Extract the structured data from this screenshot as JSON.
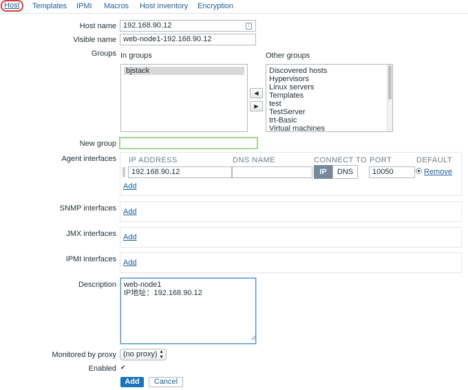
{
  "tabs": [
    {
      "label": "Host",
      "active": true
    },
    {
      "label": "Templates"
    },
    {
      "label": "IPMI"
    },
    {
      "label": "Macros"
    },
    {
      "label": "Host inventory"
    },
    {
      "label": "Encryption"
    }
  ],
  "form": {
    "host_name": {
      "label": "Host name",
      "value": "192.168.90.12"
    },
    "visible_name": {
      "label": "Visible name",
      "value": "web-node1-192.168.90.12"
    },
    "groups": {
      "label": "Groups",
      "in_groups_label": "In groups",
      "other_groups_label": "Other groups",
      "in_groups": [
        "bjstack"
      ],
      "other_groups": [
        "Discovered hosts",
        "Hypervisors",
        "Linux servers",
        "Templates",
        "test",
        "TestServer",
        "trt-Basic",
        "Virtual machines"
      ],
      "move_left": "◀",
      "move_right": "▶"
    },
    "new_group": {
      "label": "New group",
      "value": ""
    },
    "agent_interfaces": {
      "label": "Agent interfaces",
      "col_ip": "IP ADDRESS",
      "col_dns": "DNS NAME",
      "col_connect": "CONNECT TO",
      "col_port": "PORT",
      "col_default": "DEFAULT",
      "ip": "192.168.90.12",
      "dns": "",
      "connect_ip": "IP",
      "connect_dns": "DNS",
      "port": "10050",
      "remove": "Remove",
      "add": "Add"
    },
    "snmp_interfaces": {
      "label": "SNMP interfaces",
      "add": "Add"
    },
    "jmx_interfaces": {
      "label": "JMX interfaces",
      "add": "Add"
    },
    "ipmi_interfaces": {
      "label": "IPMI interfaces",
      "add": "Add"
    },
    "description": {
      "label": "Description",
      "value": "web-node1\nIP地址：192.168.90.12"
    },
    "monitored_by_proxy": {
      "label": "Monitored by proxy",
      "value": "(no proxy)"
    },
    "enabled": {
      "label": "Enabled",
      "checked": "✔"
    }
  },
  "buttons": {
    "add": "Add",
    "cancel": "Cancel"
  },
  "colors": {
    "link": "#1f5c99",
    "primary": "#1a73bb",
    "tab_highlight": "#d93a3a",
    "focus": "#a4d68e"
  }
}
